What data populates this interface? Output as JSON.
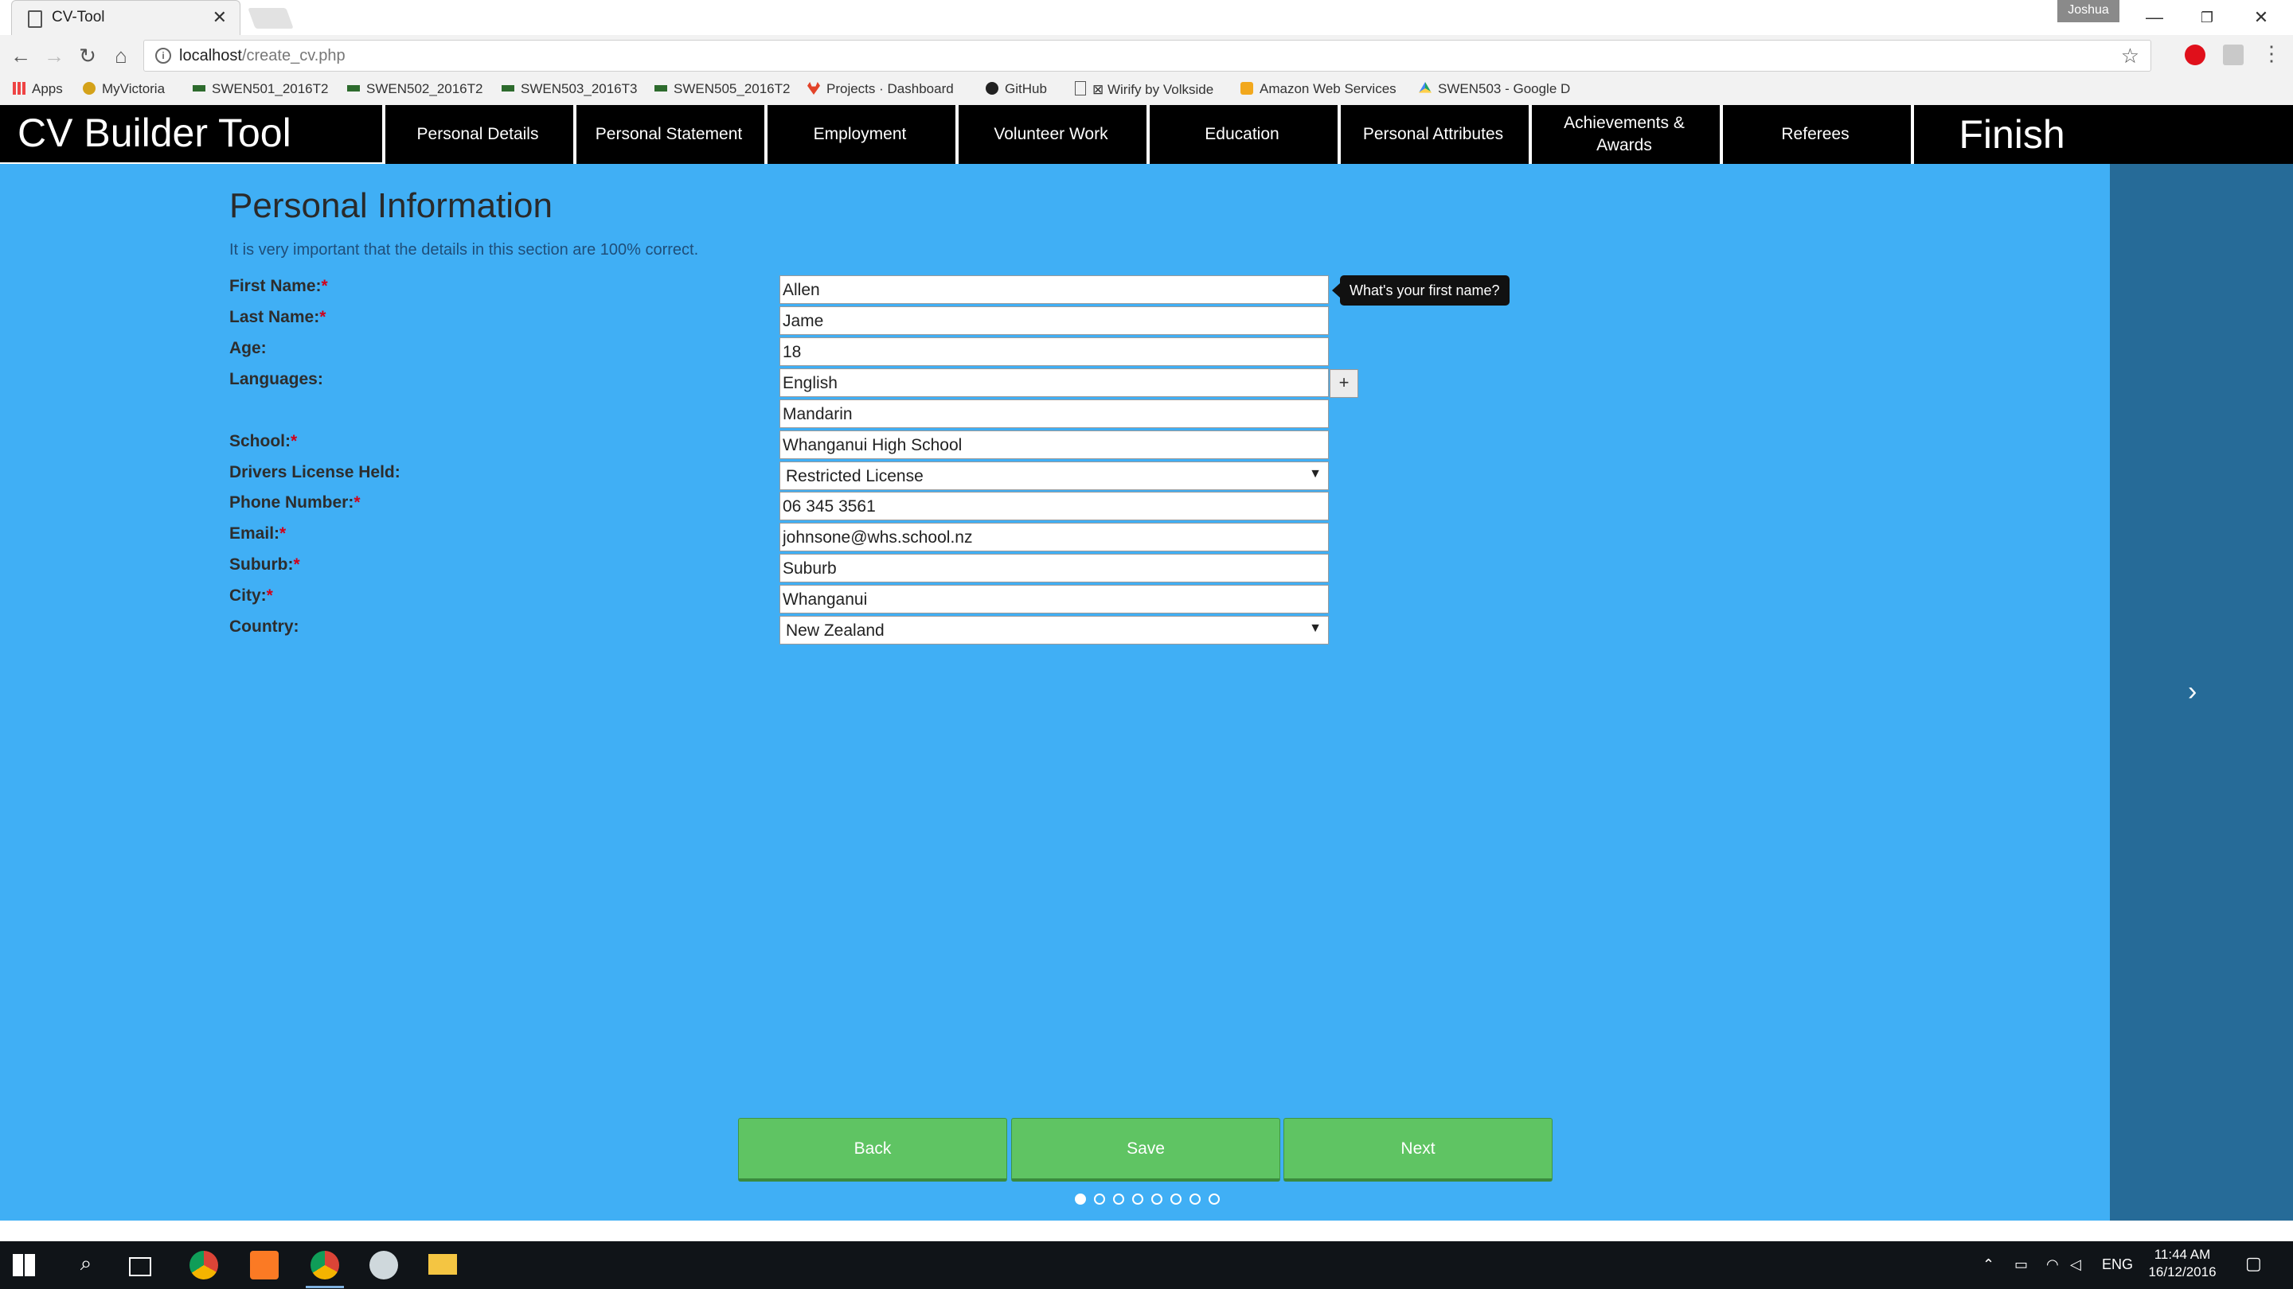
{
  "browser": {
    "tab_title": "CV-Tool",
    "user_badge": "Joshua",
    "url_host": "localhost",
    "url_path": "/create_cv.php",
    "bookmarks": [
      "Apps",
      "MyVictoria",
      "SWEN501_2016T2",
      "SWEN502_2016T2",
      "SWEN503_2016T3",
      "SWEN505_2016T2",
      "Projects · Dashboard",
      "GitHub",
      "Wirify by Volkside",
      "Amazon Web Services",
      "SWEN503 - Google D"
    ]
  },
  "app": {
    "brand": "CV Builder Tool",
    "nav": [
      "Personal Details",
      "Personal Statement",
      "Employment",
      "Volunteer Work",
      "Education",
      "Personal Attributes",
      "Achievements & Awards",
      "Referees",
      "Finish"
    ]
  },
  "form": {
    "heading": "Personal Information",
    "intro": "It is very important that the details in this section are 100% correct.",
    "labels": {
      "first_name": "First Name:",
      "last_name": "Last Name:",
      "age": "Age:",
      "languages": "Languages:",
      "school": "School:",
      "license": "Drivers License Held:",
      "phone": "Phone Number:",
      "email": "Email:",
      "suburb": "Suburb:",
      "city": "City:",
      "country": "Country:"
    },
    "required_mark": "*",
    "values": {
      "first_name": "Allen",
      "last_name": "Jame",
      "age": "18",
      "language_1": "English",
      "language_2": "Mandarin",
      "school": "Whanganui High School",
      "license": "Restricted License",
      "phone": "06 345 3561",
      "email": "johnsone@whs.school.nz",
      "suburb": "Suburb",
      "city": "Whanganui",
      "country": "New Zealand"
    },
    "add_language_label": "+",
    "tooltip": "What's your first name?"
  },
  "actions": {
    "back": "Back",
    "save": "Save",
    "next": "Next"
  },
  "pager": {
    "total": 8,
    "current": 1
  },
  "side_arrow": "›",
  "taskbar": {
    "lang": "ENG",
    "time": "11:44 AM",
    "date": "16/12/2016"
  },
  "colors": {
    "page_bg": "#40aff5",
    "side_panel": "#266b98",
    "nav_bg": "#000000",
    "button_green": "#5fc463"
  }
}
